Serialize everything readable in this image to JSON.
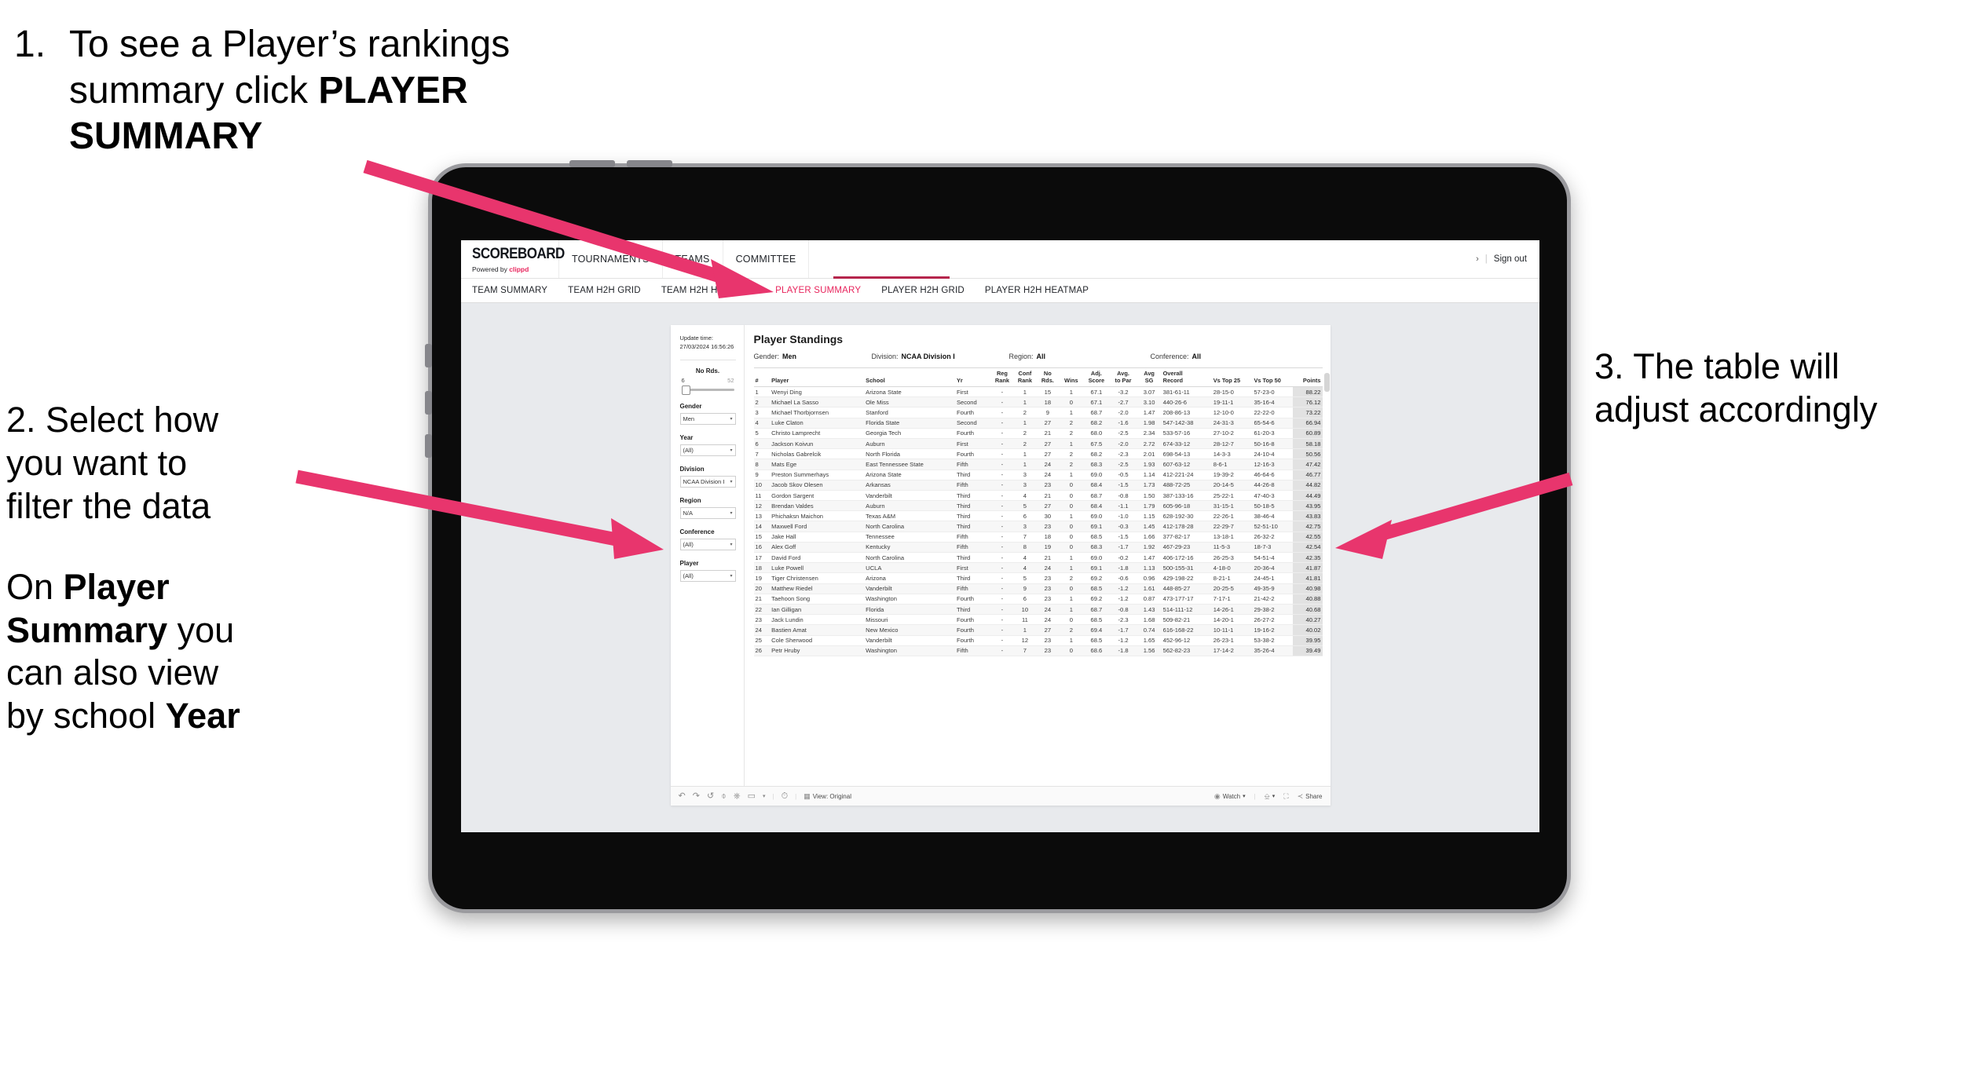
{
  "annotations": {
    "step1": {
      "number": "1.",
      "text_plain_1": "To see a Player’s rankings",
      "text_plain_2": "summary click ",
      "text_bold_1": "PLAYER",
      "text_bold_2": "SUMMARY"
    },
    "step2": {
      "line1": "2. Select how",
      "line2": "you want to",
      "line3": "filter the data",
      "para2_a": "On ",
      "para2_b_bold": "Player",
      "para2_c_bold": "Summary",
      "para2_d": " you",
      "para2_e": "can also view",
      "para2_f": "by school ",
      "para2_g_bold": "Year"
    },
    "step3": {
      "line1": "3. The table will",
      "line2": "adjust accordingly"
    }
  },
  "colors": {
    "accent_pink": "#e8245c",
    "arrow_pink": "#e8356d",
    "underline": "#b5254c"
  },
  "app": {
    "logo": {
      "main": "SCOREBOARD",
      "sub_prefix": "Powered by ",
      "sub_brand": "clippd"
    },
    "top_nav": [
      {
        "label": "TOURNAMENTS"
      },
      {
        "label": "TEAMS"
      },
      {
        "label": "COMMITTEE"
      }
    ],
    "top_right": {
      "chevron": "›",
      "separator": "|",
      "sign_out": "Sign out"
    },
    "sub_nav": [
      {
        "label": "TEAM SUMMARY",
        "active": false
      },
      {
        "label": "TEAM H2H GRID",
        "active": false
      },
      {
        "label": "TEAM H2H HEATMAP",
        "active": false
      },
      {
        "label": "PLAYER SUMMARY",
        "active": true
      },
      {
        "label": "PLAYER H2H GRID",
        "active": false
      },
      {
        "label": "PLAYER H2H HEATMAP",
        "active": false
      }
    ]
  },
  "filters": {
    "update_time_label": "Update time:",
    "update_time_value": "27/03/2024 16:56:26",
    "no_rds": {
      "label": "No Rds.",
      "min": "6",
      "max": "52"
    },
    "selects": [
      {
        "label": "Gender",
        "value": "Men"
      },
      {
        "label": "Year",
        "value": "(All)"
      },
      {
        "label": "Division",
        "value": "NCAA Division I"
      },
      {
        "label": "Region",
        "value": "N/A"
      },
      {
        "label": "Conference",
        "value": "(All)"
      },
      {
        "label": "Player",
        "value": "(All)"
      }
    ]
  },
  "viz": {
    "title": "Player Standings",
    "meta": [
      {
        "label": "Gender:",
        "value": "Men"
      },
      {
        "label": "Division:",
        "value": "NCAA Division I"
      },
      {
        "label": "Region:",
        "value": "All"
      },
      {
        "label": "Conference:",
        "value": "All"
      }
    ],
    "toolbar": {
      "undo": "undo-icon",
      "redo": "redo-icon",
      "revert": "revert-icon",
      "refresh": "refresh-icon",
      "pause": "pause-icon",
      "rect_select": "rect-select-icon",
      "dropdown": "▾",
      "history": "history-icon",
      "view_label": "View: Original",
      "watch_label": "Watch",
      "watch_caret": "▾",
      "download_caret": "▾",
      "share_label": "Share"
    }
  },
  "table": {
    "columns": [
      {
        "id": "num",
        "l1": "#",
        "l2": ""
      },
      {
        "id": "player",
        "l1": "Player",
        "l2": ""
      },
      {
        "id": "school",
        "l1": "School",
        "l2": ""
      },
      {
        "id": "yr",
        "l1": "Yr",
        "l2": ""
      },
      {
        "id": "reg",
        "l1": "Reg",
        "l2": "Rank"
      },
      {
        "id": "conf",
        "l1": "Conf",
        "l2": "Rank"
      },
      {
        "id": "nords",
        "l1": "No",
        "l2": "Rds."
      },
      {
        "id": "wins",
        "l1": "Wins",
        "l2": ""
      },
      {
        "id": "adj",
        "l1": "Adj.",
        "l2": "Score"
      },
      {
        "id": "par",
        "l1": "Avg.",
        "l2": "to Par"
      },
      {
        "id": "sg",
        "l1": "Avg",
        "l2": "SG"
      },
      {
        "id": "rec",
        "l1": "Overall",
        "l2": "Record"
      },
      {
        "id": "t25",
        "l1": "Vs Top 25",
        "l2": ""
      },
      {
        "id": "t50",
        "l1": "Vs Top 50",
        "l2": ""
      },
      {
        "id": "pts",
        "l1": "Points",
        "l2": ""
      }
    ],
    "rows": [
      {
        "num": "1",
        "player": "Wenyi Ding",
        "school": "Arizona State",
        "yr": "First",
        "reg": "-",
        "conf": "1",
        "nords": "15",
        "wins": "1",
        "adj": "67.1",
        "par": "-3.2",
        "sg": "3.07",
        "rec": "381-61-11",
        "t25": "28-15-0",
        "t50": "57-23-0",
        "pts": "88.22"
      },
      {
        "num": "2",
        "player": "Michael La Sasso",
        "school": "Ole Miss",
        "yr": "Second",
        "reg": "-",
        "conf": "1",
        "nords": "18",
        "wins": "0",
        "adj": "67.1",
        "par": "-2.7",
        "sg": "3.10",
        "rec": "440-26-6",
        "t25": "19-11-1",
        "t50": "35-16-4",
        "pts": "76.12"
      },
      {
        "num": "3",
        "player": "Michael Thorbjornsen",
        "school": "Stanford",
        "yr": "Fourth",
        "reg": "-",
        "conf": "2",
        "nords": "9",
        "wins": "1",
        "adj": "68.7",
        "par": "-2.0",
        "sg": "1.47",
        "rec": "208-86-13",
        "t25": "12-10-0",
        "t50": "22-22-0",
        "pts": "73.22"
      },
      {
        "num": "4",
        "player": "Luke Claton",
        "school": "Florida State",
        "yr": "Second",
        "reg": "-",
        "conf": "1",
        "nords": "27",
        "wins": "2",
        "adj": "68.2",
        "par": "-1.6",
        "sg": "1.98",
        "rec": "547-142-38",
        "t25": "24-31-3",
        "t50": "65-54-6",
        "pts": "66.94"
      },
      {
        "num": "5",
        "player": "Christo Lamprecht",
        "school": "Georgia Tech",
        "yr": "Fourth",
        "reg": "-",
        "conf": "2",
        "nords": "21",
        "wins": "2",
        "adj": "68.0",
        "par": "-2.5",
        "sg": "2.34",
        "rec": "533-57-16",
        "t25": "27-10-2",
        "t50": "61-20-3",
        "pts": "60.89"
      },
      {
        "num": "6",
        "player": "Jackson Koivun",
        "school": "Auburn",
        "yr": "First",
        "reg": "-",
        "conf": "2",
        "nords": "27",
        "wins": "1",
        "adj": "67.5",
        "par": "-2.0",
        "sg": "2.72",
        "rec": "674-33-12",
        "t25": "28-12-7",
        "t50": "50-16-8",
        "pts": "58.18"
      },
      {
        "num": "7",
        "player": "Nicholas Gabrelcik",
        "school": "North Florida",
        "yr": "Fourth",
        "reg": "-",
        "conf": "1",
        "nords": "27",
        "wins": "2",
        "adj": "68.2",
        "par": "-2.3",
        "sg": "2.01",
        "rec": "698-54-13",
        "t25": "14-3-3",
        "t50": "24-10-4",
        "pts": "50.56"
      },
      {
        "num": "8",
        "player": "Mats Ege",
        "school": "East Tennessee State",
        "yr": "Fifth",
        "reg": "-",
        "conf": "1",
        "nords": "24",
        "wins": "2",
        "adj": "68.3",
        "par": "-2.5",
        "sg": "1.93",
        "rec": "607-63-12",
        "t25": "8-6-1",
        "t50": "12-16-3",
        "pts": "47.42"
      },
      {
        "num": "9",
        "player": "Preston Summerhays",
        "school": "Arizona State",
        "yr": "Third",
        "reg": "-",
        "conf": "3",
        "nords": "24",
        "wins": "1",
        "adj": "69.0",
        "par": "-0.5",
        "sg": "1.14",
        "rec": "412-221-24",
        "t25": "19-39-2",
        "t50": "46-64-6",
        "pts": "46.77"
      },
      {
        "num": "10",
        "player": "Jacob Skov Olesen",
        "school": "Arkansas",
        "yr": "Fifth",
        "reg": "-",
        "conf": "3",
        "nords": "23",
        "wins": "0",
        "adj": "68.4",
        "par": "-1.5",
        "sg": "1.73",
        "rec": "488-72-25",
        "t25": "20-14-5",
        "t50": "44-26-8",
        "pts": "44.82"
      },
      {
        "num": "11",
        "player": "Gordon Sargent",
        "school": "Vanderbilt",
        "yr": "Third",
        "reg": "-",
        "conf": "4",
        "nords": "21",
        "wins": "0",
        "adj": "68.7",
        "par": "-0.8",
        "sg": "1.50",
        "rec": "387-133-16",
        "t25": "25-22-1",
        "t50": "47-40-3",
        "pts": "44.49"
      },
      {
        "num": "12",
        "player": "Brendan Valdes",
        "school": "Auburn",
        "yr": "Third",
        "reg": "-",
        "conf": "5",
        "nords": "27",
        "wins": "0",
        "adj": "68.4",
        "par": "-1.1",
        "sg": "1.79",
        "rec": "605-96-18",
        "t25": "31-15-1",
        "t50": "50-18-5",
        "pts": "43.95"
      },
      {
        "num": "13",
        "player": "Phichaksn Maichon",
        "school": "Texas A&M",
        "yr": "Third",
        "reg": "-",
        "conf": "6",
        "nords": "30",
        "wins": "1",
        "adj": "69.0",
        "par": "-1.0",
        "sg": "1.15",
        "rec": "628-192-30",
        "t25": "22-26-1",
        "t50": "38-46-4",
        "pts": "43.83"
      },
      {
        "num": "14",
        "player": "Maxwell Ford",
        "school": "North Carolina",
        "yr": "Third",
        "reg": "-",
        "conf": "3",
        "nords": "23",
        "wins": "0",
        "adj": "69.1",
        "par": "-0.3",
        "sg": "1.45",
        "rec": "412-178-28",
        "t25": "22-29-7",
        "t50": "52-51-10",
        "pts": "42.75"
      },
      {
        "num": "15",
        "player": "Jake Hall",
        "school": "Tennessee",
        "yr": "Fifth",
        "reg": "-",
        "conf": "7",
        "nords": "18",
        "wins": "0",
        "adj": "68.5",
        "par": "-1.5",
        "sg": "1.66",
        "rec": "377-82-17",
        "t25": "13-18-1",
        "t50": "26-32-2",
        "pts": "42.55"
      },
      {
        "num": "16",
        "player": "Alex Goff",
        "school": "Kentucky",
        "yr": "Fifth",
        "reg": "-",
        "conf": "8",
        "nords": "19",
        "wins": "0",
        "adj": "68.3",
        "par": "-1.7",
        "sg": "1.92",
        "rec": "467-29-23",
        "t25": "11-5-3",
        "t50": "18-7-3",
        "pts": "42.54"
      },
      {
        "num": "17",
        "player": "David Ford",
        "school": "North Carolina",
        "yr": "Third",
        "reg": "-",
        "conf": "4",
        "nords": "21",
        "wins": "1",
        "adj": "69.0",
        "par": "-0.2",
        "sg": "1.47",
        "rec": "406-172-16",
        "t25": "26-25-3",
        "t50": "54-51-4",
        "pts": "42.35"
      },
      {
        "num": "18",
        "player": "Luke Powell",
        "school": "UCLA",
        "yr": "First",
        "reg": "-",
        "conf": "4",
        "nords": "24",
        "wins": "1",
        "adj": "69.1",
        "par": "-1.8",
        "sg": "1.13",
        "rec": "500-155-31",
        "t25": "4-18-0",
        "t50": "20-36-4",
        "pts": "41.87"
      },
      {
        "num": "19",
        "player": "Tiger Christensen",
        "school": "Arizona",
        "yr": "Third",
        "reg": "-",
        "conf": "5",
        "nords": "23",
        "wins": "2",
        "adj": "69.2",
        "par": "-0.6",
        "sg": "0.96",
        "rec": "429-198-22",
        "t25": "8-21-1",
        "t50": "24-45-1",
        "pts": "41.81"
      },
      {
        "num": "20",
        "player": "Matthew Riedel",
        "school": "Vanderbilt",
        "yr": "Fifth",
        "reg": "-",
        "conf": "9",
        "nords": "23",
        "wins": "0",
        "adj": "68.5",
        "par": "-1.2",
        "sg": "1.61",
        "rec": "448-85-27",
        "t25": "20-25-5",
        "t50": "49-35-9",
        "pts": "40.98"
      },
      {
        "num": "21",
        "player": "Taehoon Song",
        "school": "Washington",
        "yr": "Fourth",
        "reg": "-",
        "conf": "6",
        "nords": "23",
        "wins": "1",
        "adj": "69.2",
        "par": "-1.2",
        "sg": "0.87",
        "rec": "473-177-17",
        "t25": "7-17-1",
        "t50": "21-42-2",
        "pts": "40.88"
      },
      {
        "num": "22",
        "player": "Ian Gilligan",
        "school": "Florida",
        "yr": "Third",
        "reg": "-",
        "conf": "10",
        "nords": "24",
        "wins": "1",
        "adj": "68.7",
        "par": "-0.8",
        "sg": "1.43",
        "rec": "514-111-12",
        "t25": "14-26-1",
        "t50": "29-38-2",
        "pts": "40.68"
      },
      {
        "num": "23",
        "player": "Jack Lundin",
        "school": "Missouri",
        "yr": "Fourth",
        "reg": "-",
        "conf": "11",
        "nords": "24",
        "wins": "0",
        "adj": "68.5",
        "par": "-2.3",
        "sg": "1.68",
        "rec": "509-82-21",
        "t25": "14-20-1",
        "t50": "26-27-2",
        "pts": "40.27"
      },
      {
        "num": "24",
        "player": "Bastien Amat",
        "school": "New Mexico",
        "yr": "Fourth",
        "reg": "-",
        "conf": "1",
        "nords": "27",
        "wins": "2",
        "adj": "69.4",
        "par": "-1.7",
        "sg": "0.74",
        "rec": "616-168-22",
        "t25": "10-11-1",
        "t50": "19-16-2",
        "pts": "40.02"
      },
      {
        "num": "25",
        "player": "Cole Sherwood",
        "school": "Vanderbilt",
        "yr": "Fourth",
        "reg": "-",
        "conf": "12",
        "nords": "23",
        "wins": "1",
        "adj": "68.5",
        "par": "-1.2",
        "sg": "1.65",
        "rec": "452-96-12",
        "t25": "26-23-1",
        "t50": "53-38-2",
        "pts": "39.95"
      },
      {
        "num": "26",
        "player": "Petr Hruby",
        "school": "Washington",
        "yr": "Fifth",
        "reg": "-",
        "conf": "7",
        "nords": "23",
        "wins": "0",
        "adj": "68.6",
        "par": "-1.8",
        "sg": "1.56",
        "rec": "562-82-23",
        "t25": "17-14-2",
        "t50": "35-26-4",
        "pts": "39.49"
      }
    ]
  }
}
